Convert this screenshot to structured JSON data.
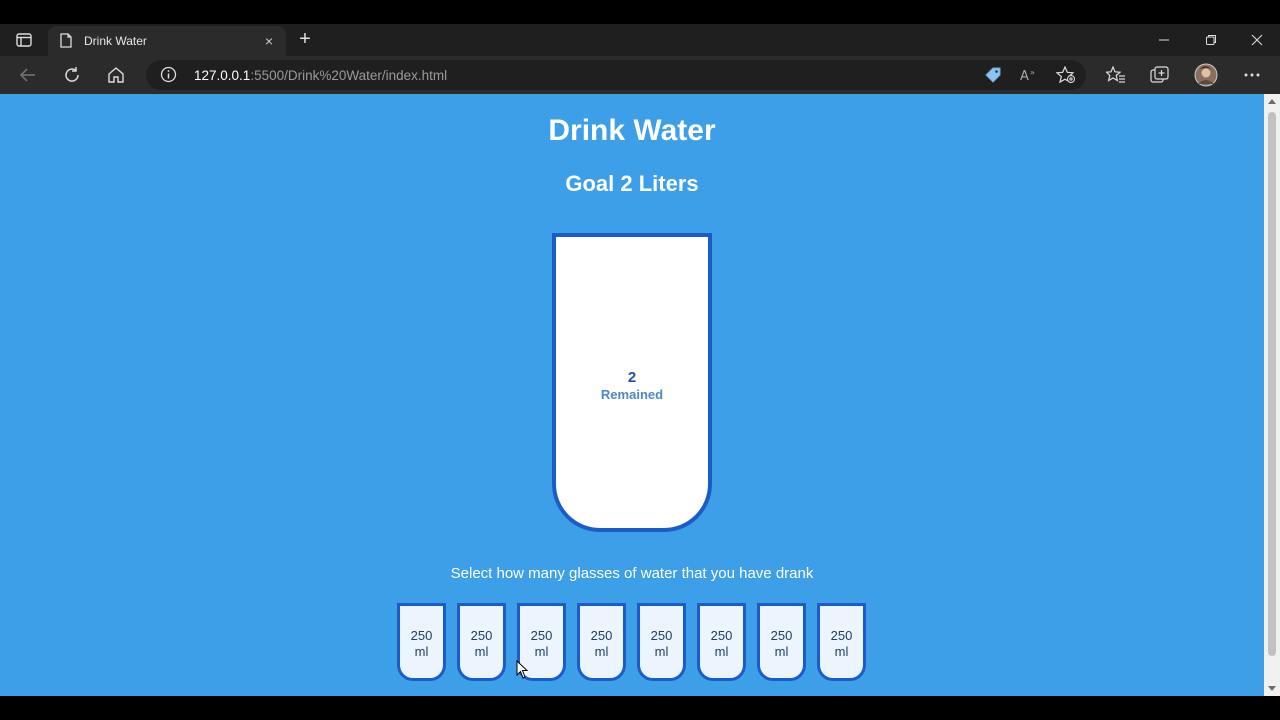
{
  "browser": {
    "tab_title": "Drink Water",
    "tab_close": "×",
    "new_tab": "+",
    "url_host": "127.0.0.1",
    "url_rest": ":5500/Drink%20Water/index.html"
  },
  "page": {
    "title": "Drink Water",
    "goal": "Goal 2 Liters",
    "remained_value": "2",
    "remained_label": "Remained",
    "filled_fraction": 0,
    "instruction": "Select how many glasses of water that you have drank",
    "small_cups": [
      {
        "amount": "250",
        "unit": "ml"
      },
      {
        "amount": "250",
        "unit": "ml"
      },
      {
        "amount": "250",
        "unit": "ml"
      },
      {
        "amount": "250",
        "unit": "ml"
      },
      {
        "amount": "250",
        "unit": "ml"
      },
      {
        "amount": "250",
        "unit": "ml"
      },
      {
        "amount": "250",
        "unit": "ml"
      },
      {
        "amount": "250",
        "unit": "ml"
      }
    ]
  },
  "colors": {
    "page_bg": "#3c9fe7",
    "cup_border": "#1c5cc9",
    "small_cup_bg": "#ecf4fd"
  }
}
